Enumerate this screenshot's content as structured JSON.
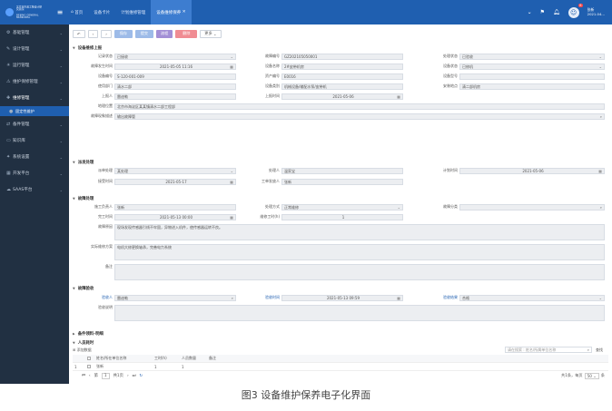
{
  "app": {
    "logo_line1": "北京市市政工程设计研究总院",
    "logo_line2": "BEIJING GENERAL MUNICIPAL"
  },
  "tabs": [
    "首页",
    "设备卡片",
    "计划维修管理",
    "设备维修保养"
  ],
  "header": {
    "badge": "8",
    "user_name": "张新",
    "user_sub": "2021.04..."
  },
  "sidebar": {
    "items": [
      {
        "label": "基础管理",
        "icon": "gear-icon"
      },
      {
        "label": "设计管理",
        "icon": "pen-icon"
      },
      {
        "label": "运行管理",
        "icon": "bulb-icon"
      },
      {
        "label": "维护保修管理",
        "icon": "warning-icon"
      },
      {
        "label": "维修管理",
        "icon": "tool-icon",
        "open": true
      },
      {
        "label": "固定性维护",
        "icon": "dot-icon",
        "sub": true,
        "selected": true
      },
      {
        "label": "备件管理",
        "icon": "share-icon"
      },
      {
        "label": "知识库",
        "icon": "folder-icon"
      },
      {
        "label": "系统设置",
        "icon": "cog-icon"
      },
      {
        "label": "开发平台",
        "icon": "code-icon"
      },
      {
        "label": "SAAS平台",
        "icon": "cloud-icon"
      }
    ]
  },
  "toolbar": {
    "save": "保存",
    "submit": "提交",
    "flow": "流程",
    "delete": "删除",
    "more": "更多"
  },
  "sec1": {
    "title": "设备维修上报",
    "rows": [
      [
        [
          "记录状态",
          "已接收",
          "select"
        ],
        [
          "故障编号",
          "GZ202105050001",
          ""
        ],
        [
          "处理状态",
          "已验收",
          "select"
        ]
      ],
      [
        [
          "故障发生时间",
          "2021-05-05 11:16",
          "date"
        ],
        [
          "设备名称",
          "2#皮带机房",
          ""
        ],
        [
          "设备状态",
          "已修机",
          "select"
        ]
      ],
      [
        [
          "设备编号",
          "S-120-001-009",
          ""
        ],
        [
          "资产编号",
          "E0016",
          ""
        ],
        [
          "设备型号",
          "",
          ""
        ]
      ],
      [
        [
          "使用部门",
          "清水二部",
          ""
        ],
        [
          "设备类别",
          "机械设备/输配水泵/皮带机",
          ""
        ],
        [
          "安装地点",
          "清二部机房",
          ""
        ]
      ],
      [
        [
          "上报人",
          "雷迪勒",
          ""
        ],
        [
          "上报时间",
          "2021-05-06",
          "date"
        ],
        [
          "",
          "",
          ""
        ]
      ]
    ],
    "address_label": "地理位置",
    "address": "北京市海淀区某某镇清水二部工程部",
    "fault_label": "故障现象描述",
    "fault": "输出故障管",
    "fault_icon": "search-icon"
  },
  "sec2": {
    "title": "派发处理",
    "rows": [
      [
        [
          "派单处理",
          "某处理",
          "select"
        ],
        [
          "处理人",
          "温家宝",
          ""
        ],
        [
          "计划时间",
          "2021-05-06",
          "date"
        ]
      ],
      [
        [
          "接受时间",
          "2021-05-17",
          "date"
        ],
        [
          "工单发放人",
          "张新",
          ""
        ],
        [
          "",
          "",
          ""
        ]
      ]
    ]
  },
  "sec3": {
    "title": "故障处理",
    "rows": [
      [
        [
          "施工负责人",
          "张新",
          ""
        ],
        [
          "处理方式",
          "正常维修",
          "select"
        ],
        [
          "故障分类",
          "",
          "search"
        ]
      ],
      [
        [
          "完工时间",
          "2021-05-13 00:00",
          "date"
        ],
        [
          "维修工时(h)",
          "1",
          "num"
        ],
        [
          "",
          "",
          ""
        ]
      ]
    ],
    "cause_label": "故障原因",
    "cause": "现场发现传感器引线不牢固，异物进入机件，使传感器运转不良。",
    "method_label": "实际维修方案",
    "method": "电机大修更换轴承，完善电力系统",
    "remark_label": "备注",
    "remark": ""
  },
  "sec4": {
    "title": "故障验收",
    "accept_person_label": "验收人",
    "accept_person": "雷迪勒",
    "accept_time_label": "验收时间",
    "accept_time": "2021-05-13 09:59",
    "accept_result_label": "验收结果",
    "accept_result": "合格",
    "opinion_label": "验收说明",
    "opinion": ""
  },
  "sec5": {
    "title": "备件领料-明细"
  },
  "sec6": {
    "title": "人员耗时",
    "add_label": "添加数据",
    "search_placeholder": "请在搜索 : 姓名/所属单位名称",
    "search_btn": "查找",
    "columns": [
      "姓名/所在单位名称",
      "工时(h)",
      "人员数量",
      "备注"
    ],
    "rows": [
      {
        "idx": "1",
        "name": "张新",
        "hours": "1",
        "count": "1",
        "note": ""
      }
    ]
  },
  "pager": {
    "page": "1",
    "total_pages": "共1页",
    "total": "共1条，每页",
    "per_page": "50"
  },
  "caption": "图3  设备维护保养电子化界面"
}
